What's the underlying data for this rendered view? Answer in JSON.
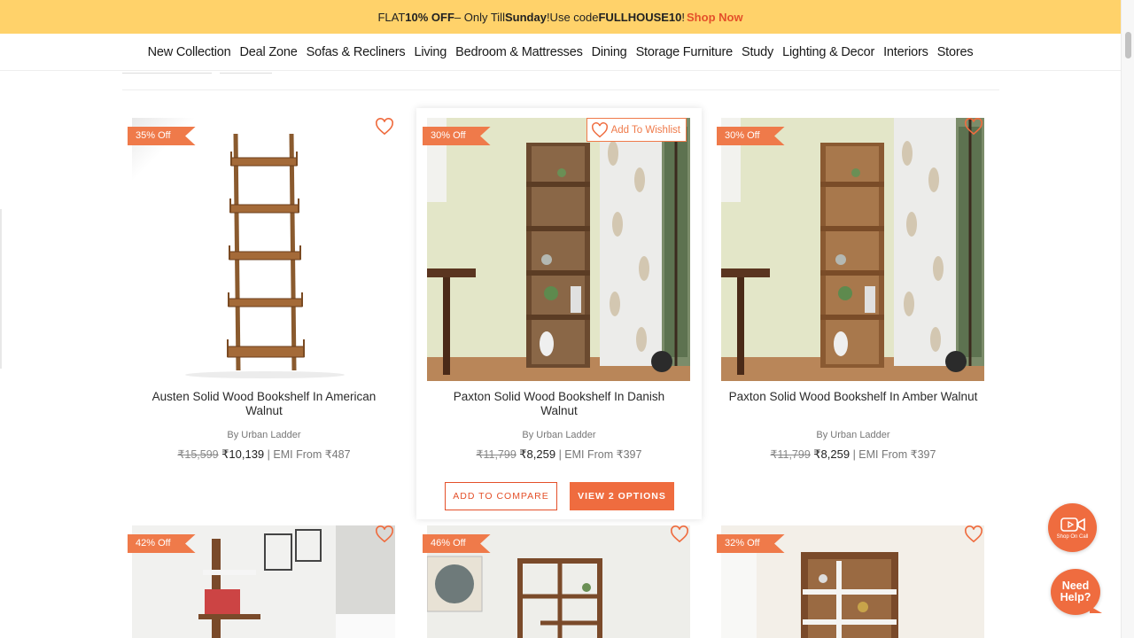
{
  "promo": {
    "prefix": "FLAT ",
    "bold1": "10% OFF",
    "middle": " – Only Till ",
    "bold2": "Sunday",
    "middle2": "!Use code ",
    "code": "FULLHOUSE10",
    "bang": "!",
    "link": "Shop Now"
  },
  "nav": [
    "New Collection",
    "Deal Zone",
    "Sofas & Recliners",
    "Living",
    "Bedroom & Mattresses",
    "Dining",
    "Storage Furniture",
    "Study",
    "Lighting & Decor",
    "Interiors",
    "Stores"
  ],
  "products": [
    {
      "badge": "35% Off",
      "title": "Austen Solid Wood Bookshelf In American Walnut",
      "by": "By Urban Ladder",
      "mrp": "₹15,599",
      "price": "₹10,139",
      "emi": "| EMI From ₹487"
    },
    {
      "badge": "30% Off",
      "wishlist": "Add To Wishlist",
      "title": "Paxton Solid Wood Bookshelf In Danish Walnut",
      "by": "By Urban Ladder",
      "mrp": "₹11,799",
      "price": "₹8,259",
      "emi": "| EMI From ₹397",
      "compare": "ADD TO COMPARE",
      "options": "VIEW 2 OPTIONS"
    },
    {
      "badge": "30% Off",
      "title": "Paxton Solid Wood Bookshelf In Amber Walnut",
      "by": "By Urban Ladder",
      "mrp": "₹11,799",
      "price": "₹8,259",
      "emi": "| EMI From ₹397"
    },
    {
      "badge": "42% Off"
    },
    {
      "badge": "46% Off"
    },
    {
      "badge": "32% Off"
    }
  ],
  "fab": {
    "shop_on_call": "Shop On Call",
    "need_help_1": "Need",
    "need_help_2": "Help?"
  },
  "colors": {
    "promo_bg": "#ffd26a",
    "accent": "#ef6c3f",
    "badge": "#ef7a4a"
  }
}
